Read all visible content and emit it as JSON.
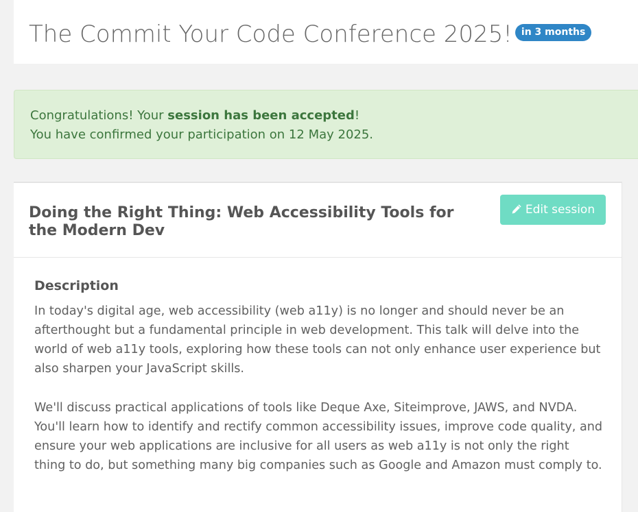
{
  "header": {
    "title": "The Commit Your Code Conference 2025!",
    "badge": "in 3 months"
  },
  "alert": {
    "prefix": "Congratulations! Your ",
    "highlight": "session has been accepted",
    "suffix": "!",
    "confirmation": "You have confirmed your participation on 12 May 2025."
  },
  "session": {
    "title": "Doing the Right Thing: Web Accessibility Tools for the Modern Dev",
    "edit_label": "Edit session",
    "description_heading": "Description",
    "description_paragraphs": [
      "In today's digital age, web accessibility (web a11y) is no longer and should never be an afterthought but a fundamental principle in web development. This talk will delve into the world of web a11y tools, exploring how these tools can not only enhance user experience but also sharpen your JavaScript skills.",
      "We'll discuss practical applications of tools like Deque Axe, Siteimprove, JAWS, and NVDA. You'll learn how to identify and rectify common accessibility issues, improve code quality, and ensure your web applications are inclusive for all users as web a11y is not only the right thing to do, but something many big companies such as Google and Amazon must comply to."
    ]
  },
  "icons": {
    "edit": "pencil-icon"
  },
  "colors": {
    "badge": "#2f86c6",
    "alert_bg": "#dff0d8",
    "alert_text": "#3c763d",
    "edit_button": "#6fdcc4"
  }
}
